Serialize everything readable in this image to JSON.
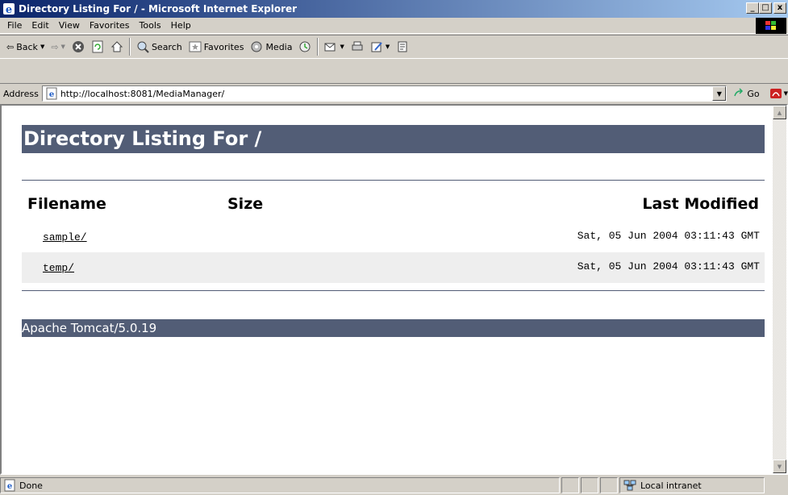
{
  "window": {
    "title": "Directory Listing For / - Microsoft Internet Explorer",
    "min": "_",
    "max": "□",
    "close": "x"
  },
  "menu": [
    "File",
    "Edit",
    "View",
    "Favorites",
    "Tools",
    "Help"
  ],
  "toolbar": {
    "back_label": "Back",
    "search_label": "Search",
    "favorites_label": "Favorites",
    "media_label": "Media"
  },
  "address": {
    "label": "Address",
    "url": "http://localhost:8081/MediaManager/",
    "go_label": "Go"
  },
  "page": {
    "heading": "Directory Listing For /",
    "columns": {
      "filename": "Filename",
      "size": "Size",
      "last_modified": "Last Modified"
    },
    "files": [
      {
        "name": "sample/",
        "size": "",
        "modified": "Sat, 05 Jun 2004 03:11:43 GMT"
      },
      {
        "name": "temp/",
        "size": "",
        "modified": "Sat, 05 Jun 2004 03:11:43 GMT"
      }
    ],
    "footer": "Apache Tomcat/5.0.19"
  },
  "status": {
    "text": "Done",
    "zone": "Local intranet"
  },
  "colors": {
    "header_bar": "#525d76",
    "alt_row": "#eeeeee",
    "title_gradient_start": "#0a246a"
  }
}
